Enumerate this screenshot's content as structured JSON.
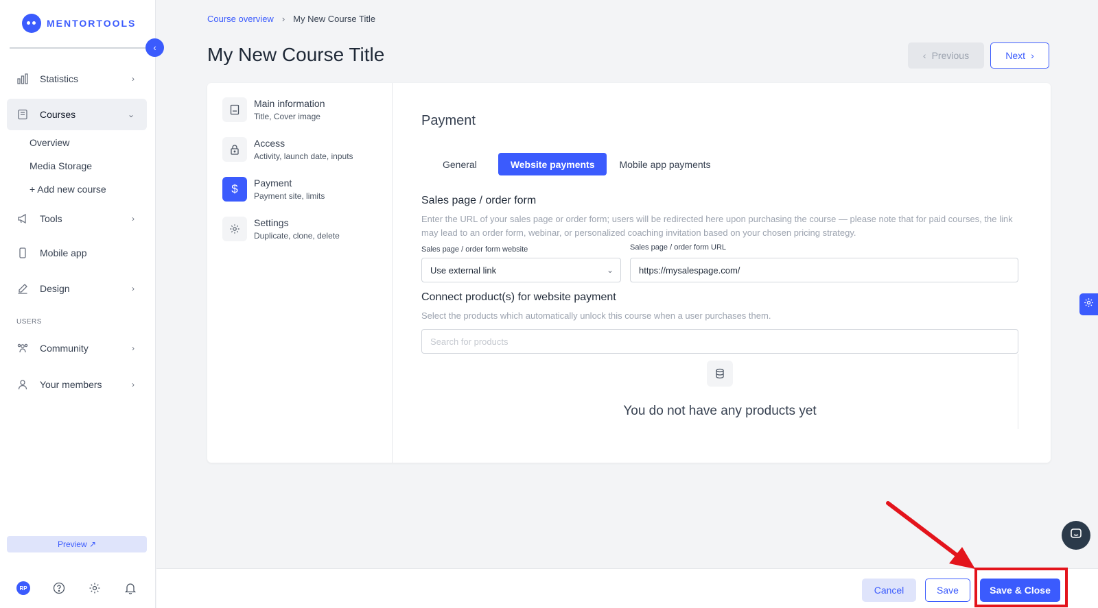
{
  "brand": {
    "name": "MENTORTOOLS"
  },
  "sidebar": {
    "items": [
      {
        "label": "Statistics"
      },
      {
        "label": "Courses"
      },
      {
        "label": "Tools"
      },
      {
        "label": "Mobile app"
      },
      {
        "label": "Design"
      },
      {
        "label": "Community"
      },
      {
        "label": "Your members"
      }
    ],
    "courses_sub": [
      "Overview",
      "Media Storage",
      "+ Add new course"
    ],
    "section_users": "USERS",
    "preview_label": "Preview ↗",
    "avatar_initials": "RP"
  },
  "breadcrumb": {
    "link": "Course overview",
    "separator": "›",
    "current": "My New Course Title"
  },
  "page": {
    "title": "My New Course Title",
    "prev_label": "Previous",
    "next_label": "Next"
  },
  "steps": [
    {
      "title": "Main information",
      "sub": "Title, Cover image"
    },
    {
      "title": "Access",
      "sub": "Activity, launch date, inputs"
    },
    {
      "title": "Payment",
      "sub": "Payment site, limits"
    },
    {
      "title": "Settings",
      "sub": "Duplicate, clone, delete"
    }
  ],
  "payment": {
    "title": "Payment",
    "tabs": [
      "General",
      "Website payments",
      "Mobile app payments"
    ],
    "active_tab": "Website payments",
    "sales_title": "Sales page / order form",
    "sales_help": "Enter the URL of your sales page or order form; users will be redirected here upon purchasing the course — please note that for paid courses, the link may lead to an order form, webinar, or personalized coaching invitation based on your chosen pricing strategy.",
    "website_label": "Sales page / order form website",
    "website_value": "Use external link",
    "url_label": "Sales page / order form URL",
    "url_value": "https://mysalespage.com/",
    "connect_title": "Connect product(s) for website payment",
    "connect_help": "Select the products which automatically unlock this course when a user purchases them.",
    "search_placeholder": "Search for products",
    "empty_text": "You do not have any products yet"
  },
  "footer": {
    "cancel_label": "Cancel",
    "save_label": "Save",
    "save_close_label": "Save & Close"
  },
  "colors": {
    "accent": "#3b5bfd",
    "highlight": "#e3141c"
  }
}
